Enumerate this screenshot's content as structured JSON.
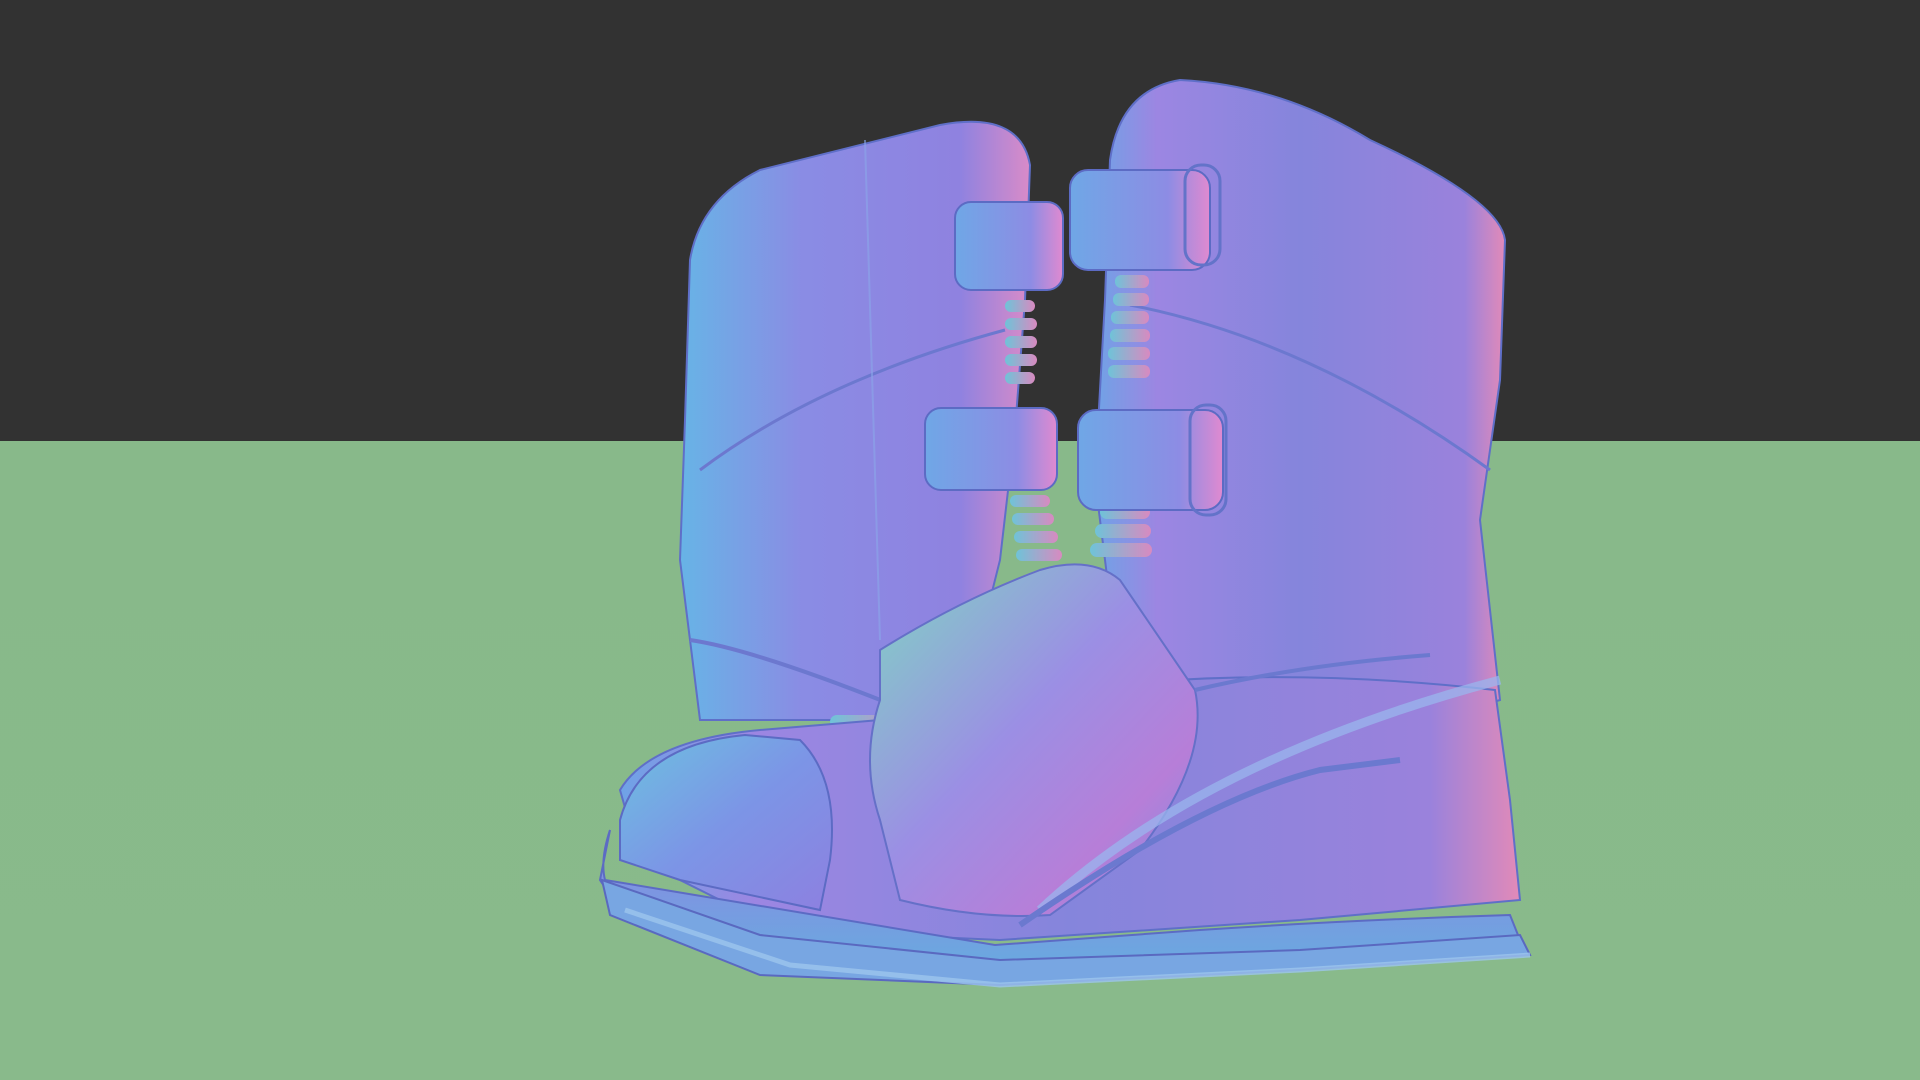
{
  "scene": {
    "subject": "boots-normal-map-render",
    "colors": {
      "background": "#323232",
      "floor": "#88b98a",
      "surface_blue": "#6f86e0",
      "surface_violet": "#9a7fe0",
      "surface_pink": "#d98ad0",
      "surface_cyan": "#6fb3e8",
      "surface_green": "#7fd0c8"
    }
  }
}
